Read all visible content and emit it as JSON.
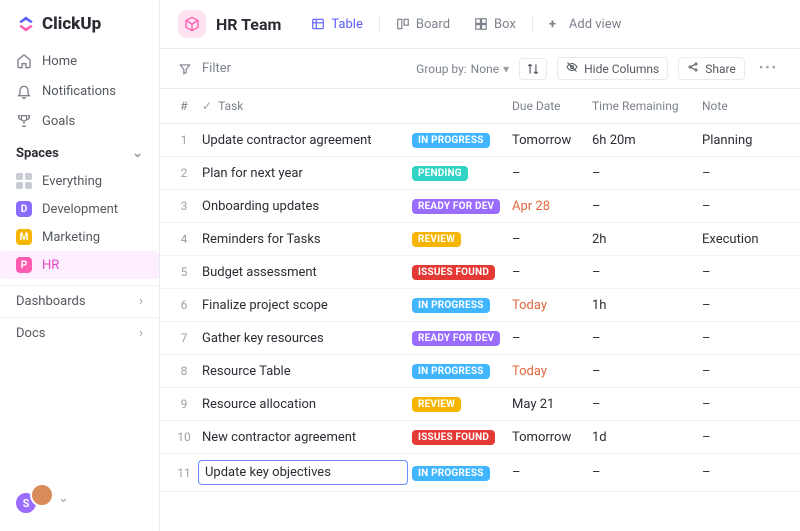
{
  "brand": "ClickUp",
  "nav": {
    "home": "Home",
    "notifications": "Notifications",
    "goals": "Goals"
  },
  "spaces": {
    "header": "Spaces",
    "everything": "Everything",
    "items": [
      {
        "letter": "D",
        "label": "Development",
        "color": "#8a6cff"
      },
      {
        "letter": "M",
        "label": "Marketing",
        "color": "#f7b500"
      },
      {
        "letter": "P",
        "label": "HR",
        "color": "#ff5bb0",
        "active": true
      }
    ]
  },
  "bottom": {
    "dashboards": "Dashboards",
    "docs": "Docs"
  },
  "header": {
    "title": "HR Team"
  },
  "views": {
    "table": "Table",
    "board": "Board",
    "box": "Box",
    "add": "Add view"
  },
  "toolbar": {
    "filter": "Filter",
    "groupby_label": "Group by:",
    "groupby_value": "None",
    "hide_columns": "Hide Columns",
    "share": "Share"
  },
  "columns": {
    "num": "#",
    "task": "Task",
    "due": "Due Date",
    "time": "Time Remaining",
    "note": "Note"
  },
  "status_colors": {
    "IN PROGRESS": "#3fb6ff",
    "PENDING": "#2fd4c4",
    "READY FOR DEV": "#9a6cff",
    "REVIEW": "#f7b500",
    "ISSUES FOUND": "#e53935"
  },
  "rows": [
    {
      "n": 1,
      "name": "Update contractor agreement",
      "status": "IN PROGRESS",
      "due": "Tomorrow",
      "due_cls": "",
      "time": "6h 20m",
      "note": "Planning"
    },
    {
      "n": 2,
      "name": "Plan for next year",
      "status": "PENDING",
      "due": "–",
      "due_cls": "",
      "time": "–",
      "note": "–"
    },
    {
      "n": 3,
      "name": "Onboarding updates",
      "status": "READY FOR DEV",
      "due": "Apr 28",
      "due_cls": "due-soon",
      "time": "–",
      "note": "–"
    },
    {
      "n": 4,
      "name": "Reminders for Tasks",
      "status": "REVIEW",
      "due": "–",
      "due_cls": "",
      "time": "2h",
      "note": "Execution"
    },
    {
      "n": 5,
      "name": "Budget assessment",
      "status": "ISSUES FOUND",
      "due": "–",
      "due_cls": "",
      "time": "–",
      "note": "–"
    },
    {
      "n": 6,
      "name": "Finalize project scope",
      "status": "IN PROGRESS",
      "due": "Today",
      "due_cls": "due-today",
      "time": "1h",
      "note": "–"
    },
    {
      "n": 7,
      "name": "Gather key resources",
      "status": "READY FOR DEV",
      "due": "–",
      "due_cls": "",
      "time": "–",
      "note": "–"
    },
    {
      "n": 8,
      "name": "Resource Table",
      "status": "IN PROGRESS",
      "due": "Today",
      "due_cls": "due-today",
      "time": "–",
      "note": "–"
    },
    {
      "n": 9,
      "name": "Resource allocation",
      "status": "REVIEW",
      "due": "May 21",
      "due_cls": "",
      "time": "–",
      "note": "–"
    },
    {
      "n": 10,
      "name": "New contractor agreement",
      "status": "ISSUES FOUND",
      "due": "Tomorrow",
      "due_cls": "",
      "time": "1d",
      "note": "–"
    },
    {
      "n": 11,
      "name": "Update key objectives",
      "status": "IN PROGRESS",
      "due": "–",
      "due_cls": "",
      "time": "–",
      "note": "–",
      "editing": true
    }
  ],
  "avatars": [
    {
      "letter": "S",
      "color": "#9a6cff"
    },
    {
      "letter": "",
      "color": "#d98b5a"
    }
  ]
}
